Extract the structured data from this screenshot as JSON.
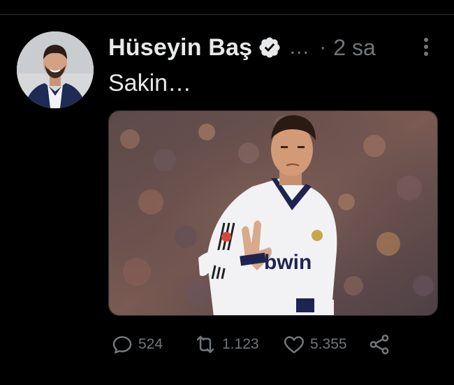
{
  "post": {
    "author": {
      "name": "Hüseyin Baş",
      "verified": true,
      "handle_truncated": "…"
    },
    "separator": "·",
    "timestamp": "2 sa",
    "text": "Sakin…",
    "media": {
      "type": "photo",
      "jersey_text": "bwin"
    },
    "metrics": {
      "replies": "524",
      "retweets": "1.123",
      "likes": "5.355"
    },
    "icons": {
      "more": "more-vertical-icon",
      "verified": "verified-badge-icon",
      "reply": "reply-icon",
      "retweet": "retweet-icon",
      "like": "heart-icon",
      "share": "share-icon"
    }
  },
  "colors": {
    "background": "#000000",
    "text_primary": "#e7e9ea",
    "text_secondary": "#71767b",
    "divider": "#2f3336"
  }
}
